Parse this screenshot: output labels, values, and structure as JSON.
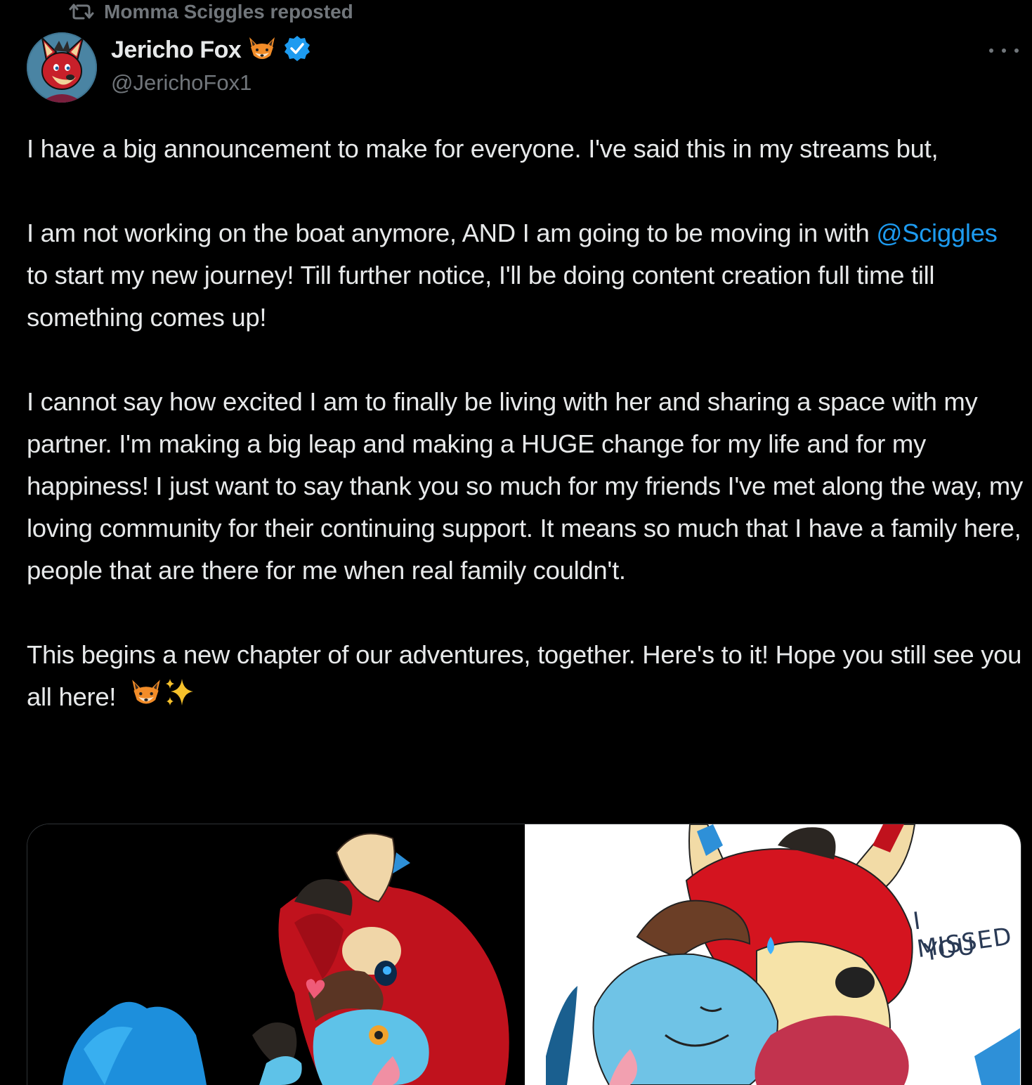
{
  "repost": {
    "label": "Momma Sciggles reposted"
  },
  "author": {
    "display_name": "Jericho Fox",
    "handle": "@JerichoFox1",
    "name_emoji_icon": "fox-face-icon",
    "verified_icon": "verified-badge-icon"
  },
  "tweet": {
    "p1": "I have a big announcement to make for everyone. I've said this in my streams but,",
    "p2_before": "I am not working on the boat anymore, AND I am going to be moving in with ",
    "p2_mention": "@Sciggles",
    "p2_after": " to start my new journey! Till further notice, I'll be doing content creation full time till something comes up!",
    "p3": "I cannot say how excited I am to finally be living with her and sharing a space with my partner. I'm making a big leap and making a HUGE change for my life and for my happiness! I just want to say thank you so much for my friends I've met along the way, my loving community for their continuing support. It means so much that I have a family here, people that are there for me when real family couldn't.",
    "p4": "This begins a new chapter of our adventures, together. Here's to it! Hope you still see you all here!",
    "p4_emoji_icons": [
      "fox-face-icon",
      "sparkles-icon"
    ]
  },
  "media": {
    "image_right_text_line1": "I MISSED",
    "image_right_text_line2": "YOU"
  },
  "colors": {
    "background": "#000000",
    "text": "#e7e9ea",
    "secondary": "#71767b",
    "link": "#1d9bf0",
    "verified": "#1d9bf0"
  }
}
